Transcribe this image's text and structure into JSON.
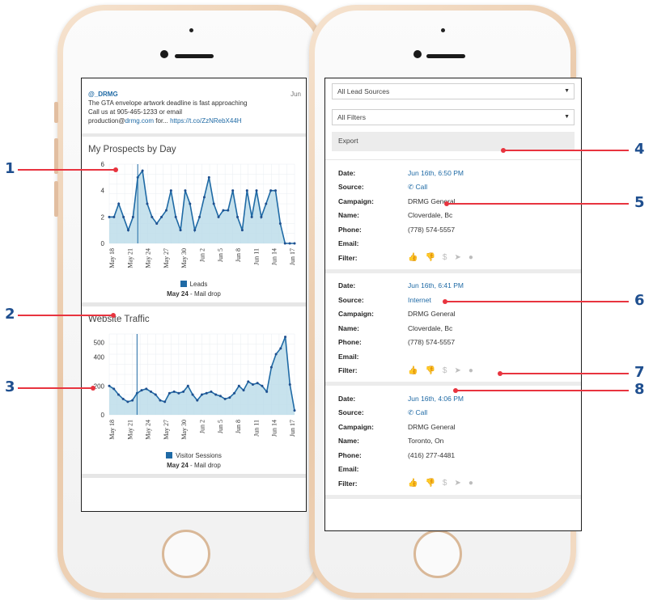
{
  "colors": {
    "accent": "#1f6aa5",
    "callout": "#e8343f",
    "callout_number": "#1f4f8f",
    "chart_fill": "#b9dbe9"
  },
  "left_phone": {
    "tweet": {
      "handle": "@_DRMG",
      "date": "Jun",
      "line1": "The GTA envelope artwork deadline is fast approaching",
      "line2": "Call us at 905-465-1233 or email",
      "line3_pre": "production@",
      "line3_link": "drmg.com",
      "line3_mid": " for... ",
      "line3_url": "https://t.co/ZzNRebX44H"
    },
    "prospects": {
      "title": "My Prospects by Day",
      "legend": "Leads",
      "note_bold": "May 24",
      "note_rest": " - Mail drop"
    },
    "traffic": {
      "title": "Website Traffic",
      "legend": "Visitor Sessions",
      "note_bold": "May 24",
      "note_rest": " - Mail drop"
    }
  },
  "chart_data": [
    {
      "type": "area",
      "title": "My Prospects by Day",
      "x_tick_labels": [
        "May 18",
        "May 21",
        "May 24",
        "May 27",
        "May 30",
        "Jun 2",
        "Jun 5",
        "Jun 8",
        "Jun 11",
        "Jun 14",
        "Jun 17"
      ],
      "y_ticks": [
        0,
        2,
        4,
        6
      ],
      "ylim": [
        0,
        6
      ],
      "series": [
        {
          "name": "Leads",
          "values": [
            2,
            2,
            3,
            2,
            1,
            2,
            5,
            5.5,
            3,
            2,
            1.5,
            2,
            2.5,
            4,
            2,
            1,
            4,
            3,
            1,
            2,
            3.5,
            5,
            3,
            2,
            2.5,
            2.5,
            4,
            2,
            1,
            4,
            2,
            4,
            2,
            3,
            4,
            4,
            1.5,
            0,
            0,
            0
          ]
        }
      ],
      "annotation_index": 6,
      "annotation": "May 24 - Mail drop"
    },
    {
      "type": "area",
      "title": "Website Traffic",
      "x_tick_labels": [
        "May 18",
        "May 21",
        "May 24",
        "May 27",
        "May 30",
        "Jun 2",
        "Jun 5",
        "Jun 8",
        "Jun 11",
        "Jun 14",
        "Jun 17"
      ],
      "y_ticks": [
        0,
        200,
        400,
        500
      ],
      "ylim": [
        0,
        560
      ],
      "series": [
        {
          "name": "Visitor Sessions",
          "values": [
            200,
            180,
            140,
            110,
            90,
            100,
            150,
            170,
            180,
            160,
            140,
            100,
            90,
            150,
            160,
            150,
            160,
            200,
            140,
            100,
            140,
            150,
            160,
            140,
            130,
            110,
            120,
            150,
            200,
            170,
            230,
            210,
            220,
            200,
            160,
            330,
            420,
            460,
            540,
            210,
            30
          ]
        }
      ],
      "annotation_index": 6,
      "annotation": "May 24 - Mail drop"
    }
  ],
  "right_phone": {
    "lead_sources": "All Lead Sources",
    "filters": "All Filters",
    "export": "Export",
    "labels": {
      "date": "Date:",
      "source": "Source:",
      "campaign": "Campaign:",
      "name": "Name:",
      "phone": "Phone:",
      "email": "Email:",
      "filter": "Filter:"
    },
    "filter_icons": [
      "thumbs-up-icon",
      "thumbs-down-icon",
      "dollar-icon",
      "send-icon",
      "comment-icon"
    ],
    "leads": [
      {
        "date": "Jun 16th, 6:50 PM",
        "source": "Call",
        "source_icon": "phone-icon",
        "campaign": "DRMG General",
        "name": "Cloverdale, Bc",
        "phone": "(778) 574-5557",
        "email": ""
      },
      {
        "date": "Jun 16th, 6:41 PM",
        "source": "Internet",
        "source_icon": "",
        "campaign": "DRMG General",
        "name": "Cloverdale, Bc",
        "phone": "(778) 574-5557",
        "email": ""
      },
      {
        "date": "Jun 16th, 4:06 PM",
        "source": "Call",
        "source_icon": "phone-icon",
        "campaign": "DRMG General",
        "name": "Toronto, On",
        "phone": "(416) 277-4481",
        "email": ""
      }
    ]
  },
  "callouts": [
    {
      "number": "1",
      "target": "prospects-chart"
    },
    {
      "number": "2",
      "target": "prospects-legend"
    },
    {
      "number": "3",
      "target": "traffic-legend"
    },
    {
      "number": "4",
      "target": "export-button"
    },
    {
      "number": "5",
      "target": "call-source"
    },
    {
      "number": "6",
      "target": "internet-source"
    },
    {
      "number": "7",
      "target": "filter-icons"
    },
    {
      "number": "8",
      "target": "phone-number"
    }
  ]
}
